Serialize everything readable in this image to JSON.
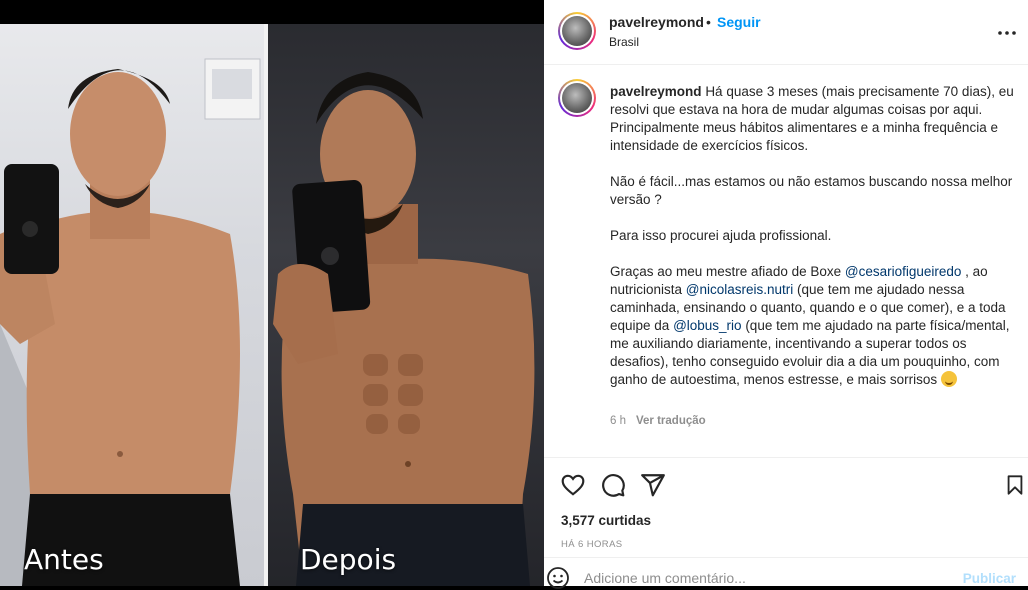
{
  "post": {
    "image": {
      "left_label": "Antes",
      "right_label": "Depois"
    }
  },
  "header": {
    "username": "pavelreymond",
    "separator": "•",
    "follow_label": "Seguir",
    "location": "Brasil",
    "more_icon": "more-horizontal-icon"
  },
  "caption": {
    "username": "pavelreymond",
    "paragraph1": "Há quase 3 meses (mais precisamente 70 dias), eu resolvi que estava na hora de mudar algumas coisas por aqui. Principalmente meus hábitos alimentares e a minha frequência e intensidade de exercícios físicos.",
    "paragraph2": "Não é fácil...mas estamos ou não estamos buscando nossa melhor versão ?",
    "paragraph3": "Para isso procurei ajuda profissional.",
    "p4_part1": "Graças ao meu mestre afiado de Boxe ",
    "p4_mention1": "@cesariofigueiredo",
    "p4_part2": " , ao nutricionista ",
    "p4_mention2": "@nicolasreis.nutri",
    "p4_part3": " (que tem me ajudado nessa caminhada, ensinando o quanto, quando e o que comer), e a toda equipe da ",
    "p4_mention3": "@lobus_rio",
    "p4_part4": " (que tem me ajudado na parte física/mental, me auxiliando diariamente, incentivando a superar todos os desafios), tenho conseguido evoluir dia a dia um pouquinho, com ganho de autoestima, menos estresse, e mais sorrisos ",
    "emoji": "smiley-emoji",
    "age": "6 h",
    "translate_label": "Ver tradução"
  },
  "actions": {
    "icons": [
      "heart-icon",
      "comment-icon",
      "share-icon",
      "bookmark-icon"
    ],
    "likes": "3,577 curtidas",
    "time": "HÁ 6 HORAS"
  },
  "comment": {
    "emoji_icon": "emoji-icon",
    "placeholder": "Adicione um comentário...",
    "publish_label": "Publicar"
  },
  "colors": {
    "accent": "#0095f6",
    "mention": "#00376b",
    "muted": "#8e8e8e",
    "publish_disabled": "#b2dffc"
  }
}
